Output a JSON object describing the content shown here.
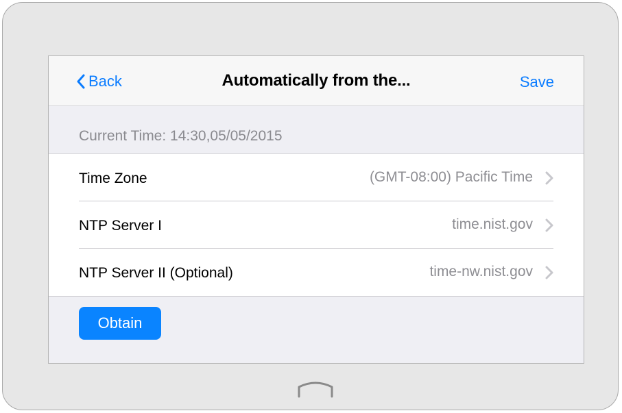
{
  "nav": {
    "back_label": "Back",
    "title": "Automatically from the...",
    "save_label": "Save"
  },
  "status": {
    "current_time": "Current Time: 14:30,05/05/2015"
  },
  "settings": [
    {
      "label": "Time Zone",
      "value": "(GMT-08:00) Pacific Time",
      "icon": "chevron-right-icon"
    },
    {
      "label": "NTP Server I",
      "value": "time.nist.gov",
      "icon": "chevron-right-icon"
    },
    {
      "label": "NTP Server II (Optional)",
      "value": "time-nw.nist.gov",
      "icon": "chevron-right-icon"
    }
  ],
  "actions": {
    "obtain_label": "Obtain"
  },
  "colors": {
    "accent": "#0a84ff",
    "link": "#0a7cff",
    "secondary_text": "#8e8e93",
    "background": "#efeff4"
  }
}
